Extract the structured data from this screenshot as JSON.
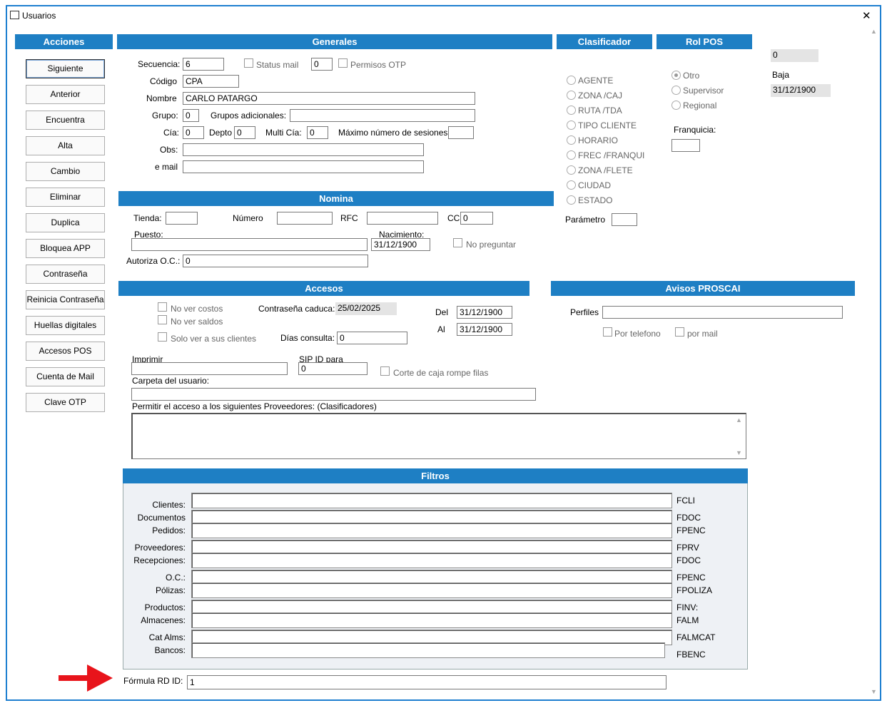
{
  "window": {
    "title": "Usuarios",
    "close": "✕"
  },
  "acciones": {
    "title": "Acciones",
    "buttons": [
      "Siguiente",
      "Anterior",
      "Encuentra",
      "Alta",
      "Cambio",
      "Eliminar",
      "Duplica",
      "Bloquea APP",
      "Contraseña",
      "Reinicia Contraseña",
      "Huellas digitales",
      "Accesos POS",
      "Cuenta de Mail",
      "Clave OTP"
    ]
  },
  "generales": {
    "title": "Generales",
    "secuencia_label": "Secuencia:",
    "secuencia": "6",
    "status_mail": "Status mail",
    "status_mail_value": "0",
    "permisos_otp": "Permisos OTP",
    "codigo_label": "Código",
    "codigo": "CPA",
    "nombre_label": "Nombre",
    "nombre": "CARLO PATARGO",
    "grupo_label": "Grupo:",
    "grupo": "0",
    "grupos_adic_label": "Grupos adicionales:",
    "grupos_adic": "",
    "cia_label": "Cía:",
    "cia": "0",
    "depto_label": "Depto",
    "depto": "0",
    "multi_cia_label": "Multi Cía:",
    "multi_cia": "0",
    "max_sesiones_label": "Máximo número de sesiones:",
    "max_sesiones": "",
    "obs_label": "Obs:",
    "obs": "",
    "email_label": "e mail",
    "email": ""
  },
  "clasificador": {
    "title": "Clasificador",
    "options": [
      "AGENTE",
      "ZONA /CAJ",
      "RUTA /TDA",
      "TIPO CLIENTE",
      "HORARIO",
      "FREC /FRANQUI",
      "ZONA /FLETE",
      "CIUDAD",
      "ESTADO"
    ],
    "parametro_label": "Parámetro",
    "parametro": ""
  },
  "rolpos": {
    "title": "Rol POS",
    "options": [
      "Otro",
      "Supervisor",
      "Regional"
    ],
    "selected": "Otro",
    "franquicia_label": "Franquicia:",
    "franquicia": ""
  },
  "right": {
    "value0": "0",
    "baja_label": "Baja",
    "baja": "31/12/1900"
  },
  "nomina": {
    "title": "Nomina",
    "tienda_label": "Tienda:",
    "tienda": "",
    "numero_label": "Número",
    "numero": "",
    "rfc_label": "RFC",
    "rfc": "",
    "cc_label": "CC",
    "cc": "0",
    "puesto_label": "Puesto:",
    "puesto": "",
    "nacimiento_label": "Nacimiento:",
    "nacimiento": "31/12/1900",
    "no_preguntar": "No preguntar",
    "autoriza_label": "Autoriza O.C.:",
    "autoriza": "0"
  },
  "accesos": {
    "title": "Accesos",
    "no_ver_costos": "No ver costos",
    "no_ver_saldos": "No ver saldos",
    "solo_ver": "Solo ver a sus clientes",
    "contrasena_caduca_label": "Contraseña caduca:",
    "contrasena_caduca": "25/02/2025",
    "del_label": "Del",
    "del": "31/12/1900",
    "al_label": "Al",
    "al": "31/12/1900",
    "dias_label": "Días consulta:",
    "dias": "0",
    "imprimir_label": "Imprimir",
    "imprimir": "",
    "sip_label": "SIP ID para",
    "sip": "0",
    "corte_caja": "Corte de caja rompe filas",
    "carpeta_label": "Carpeta del usuario:",
    "carpeta": "",
    "proveedores_label": "Permitir el acceso a los siguientes Proveedores: (Clasificadores)"
  },
  "avisos": {
    "title": "Avisos PROSCAI",
    "perfiles_label": "Perfiles",
    "perfiles": "",
    "por_telefono": "Por telefono",
    "por_mail": "por mail"
  },
  "filtros": {
    "title": "Filtros",
    "rows": [
      {
        "label": "Clientes:",
        "code": "FCLI"
      },
      {
        "label": "Documentos",
        "code": "FDOC"
      },
      {
        "label": "Pedidos:",
        "code": "FPENC"
      },
      {
        "label": "Proveedores:",
        "code": "FPRV"
      },
      {
        "label": "Recepciones:",
        "code": "FDOC"
      },
      {
        "label": "O.C.:",
        "code": "FPENC"
      },
      {
        "label": "Pólizas:",
        "code": "FPOLIZA"
      },
      {
        "label": "Productos:",
        "code": "FINV:"
      },
      {
        "label": "Almacenes:",
        "code": "FALM"
      },
      {
        "label": "Cat Alms:",
        "code": "FALMCAT"
      },
      {
        "label": "Bancos:",
        "code": "FBENC"
      }
    ]
  },
  "formula": {
    "label": "Fórmula RD ID:",
    "value": "1"
  },
  "colors": {
    "accent": "#1e7fc4",
    "border": "#1e7fd0",
    "arrow": "#e8141b"
  }
}
